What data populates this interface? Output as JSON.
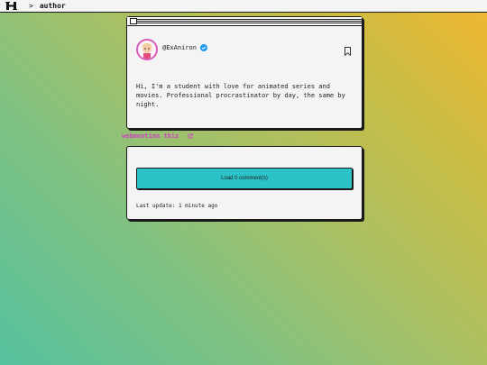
{
  "topbar": {
    "logo_icon": "site-logo-icon",
    "separator": ">",
    "breadcrumb": "author"
  },
  "author_card": {
    "handle": "@ExAniron",
    "verified_icon": "verified-badge-icon",
    "bookmark_icon": "bookmark-icon",
    "bio": "Hi, I'm a student with love for animated series and movies. Professional procrastinator by day, the same by night."
  },
  "webmention": {
    "label": "webmention this",
    "icon": "external-link-icon"
  },
  "comments": {
    "load_label": "Load 0 comment(s)",
    "last_update": "Last update: 1 minute ago"
  },
  "colors": {
    "accent": "#2bc2c8",
    "link": "#d23fc4",
    "verified": "#1d9bf0"
  }
}
